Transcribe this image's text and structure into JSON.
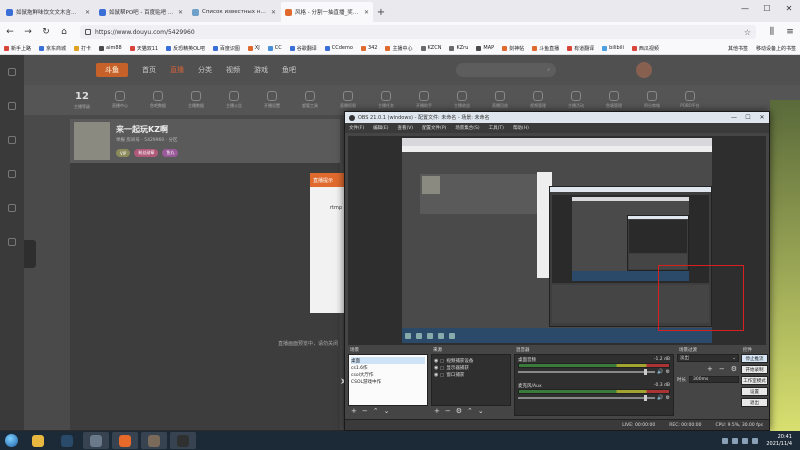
{
  "browser": {
    "tabs": [
      {
        "label": "如鼠拖鲜味饮文文木含有部区",
        "active": false,
        "color": "#3b6fd8"
      },
      {
        "label": "如鼠帮PO吧 - 百度贴吧 - 全扣",
        "active": false,
        "color": "#3b6fd8"
      },
      {
        "label": "Список известных нам карт",
        "active": false,
        "color": "#6fa0c8"
      },
      {
        "label": "风格 - 分割一抽直播_奖励精彩",
        "active": true,
        "color": "#e06a2e"
      }
    ],
    "url": "https://www.douyu.com/5429960",
    "bookmarks": [
      "新手上路",
      "京东商城",
      "打卡",
      "aim88",
      "天猫双11",
      "反恐精英OL吧",
      "百度识图",
      "XJ",
      "CC",
      "谷歌翻译",
      "CCdemo",
      "342",
      "主播中心",
      "KZCN",
      "KZru",
      "MAP",
      "剑神帖",
      "斗鱼直播",
      "有道翻译",
      "bilibili",
      "西瓜视频"
    ],
    "bookmarks_right": [
      "其他书签",
      "移动设备上的书签"
    ]
  },
  "douyu": {
    "logo": "斗鱼",
    "nav": [
      "首页",
      "直播",
      "分类",
      "视频",
      "游戏",
      "鱼吧"
    ],
    "active_nav": "直播",
    "categories": [
      {
        "num": "12",
        "label": "主播等级"
      },
      {
        "label": "直播中心"
      },
      {
        "label": "鱼吧数据"
      },
      {
        "label": "主播数据"
      },
      {
        "label": "主播公告"
      },
      {
        "label": "开播设置"
      },
      {
        "label": "超管工具"
      },
      {
        "label": "直播权限"
      },
      {
        "label": "主播任务"
      },
      {
        "label": "开播助手"
      },
      {
        "label": "主播收益"
      },
      {
        "label": "直播回放"
      },
      {
        "label": "视频管理"
      },
      {
        "label": "主播活动"
      },
      {
        "label": "鱼塘管理"
      },
      {
        "label": "积分商城"
      },
      {
        "label": "POBO平台"
      }
    ],
    "room": {
      "title": "来一起玩KZ啊",
      "meta": "举报  房间号 · 5429960 · 分区",
      "tags": [
        "VIP",
        "粉丝勋章",
        "鱼丸"
      ]
    },
    "popup_header": "直播提示",
    "popup_text": "rtmp",
    "video_caption": "直播画面预览中，请勿关闭"
  },
  "obs": {
    "title": "OBS 21.0.1 (windows) - 配置文件: 未命名 - 场景: 未命名",
    "menu": [
      "文件(F)",
      "编辑(E)",
      "查看(V)",
      "配置文件(P)",
      "场景集合(S)",
      "工具(T)",
      "帮助(H)"
    ],
    "docks": {
      "scenes": {
        "title": "场景",
        "items": [
          "桌面",
          "cs1.6作",
          "csol大厅作",
          "CSOL游戏中作"
        ],
        "selected": 0
      },
      "sources": {
        "title": "来源",
        "items": [
          "视频捕获设备",
          "显示器捕获",
          "窗口捕获"
        ]
      },
      "mixer": {
        "title": "混音器",
        "channels": [
          {
            "name": "桌面音频",
            "db": "-1.2 dB"
          },
          {
            "name": "麦克风/Aux",
            "db": "-0.3 dB"
          }
        ]
      },
      "transitions": {
        "title": "场景过渡",
        "type": "淡出",
        "duration_label": "时长",
        "duration": "300ms"
      },
      "controls": {
        "title": "控件",
        "buttons": [
          "停止推流",
          "开始录制",
          "工作室模式",
          "设置",
          "退出"
        ],
        "active_button": "停止推流"
      }
    },
    "status": {
      "live": "LIVE: 00:00:00",
      "rec": "REC: 00:00:00",
      "cpu": "CPU: 9.5%, 30.00 fps"
    }
  },
  "taskbar": {
    "apps": [
      {
        "name": "explorer",
        "color": "#e8b840"
      },
      {
        "name": "steam",
        "color": "#2a4a6a"
      },
      {
        "name": "counter-strike-1",
        "color": "#6a7a8a"
      },
      {
        "name": "firefox",
        "color": "#e86a2a"
      },
      {
        "name": "counter-strike-2",
        "color": "#7a6a5a"
      },
      {
        "name": "obs",
        "color": "#303030"
      }
    ],
    "time": "20:41",
    "date": "2021/11/4"
  }
}
